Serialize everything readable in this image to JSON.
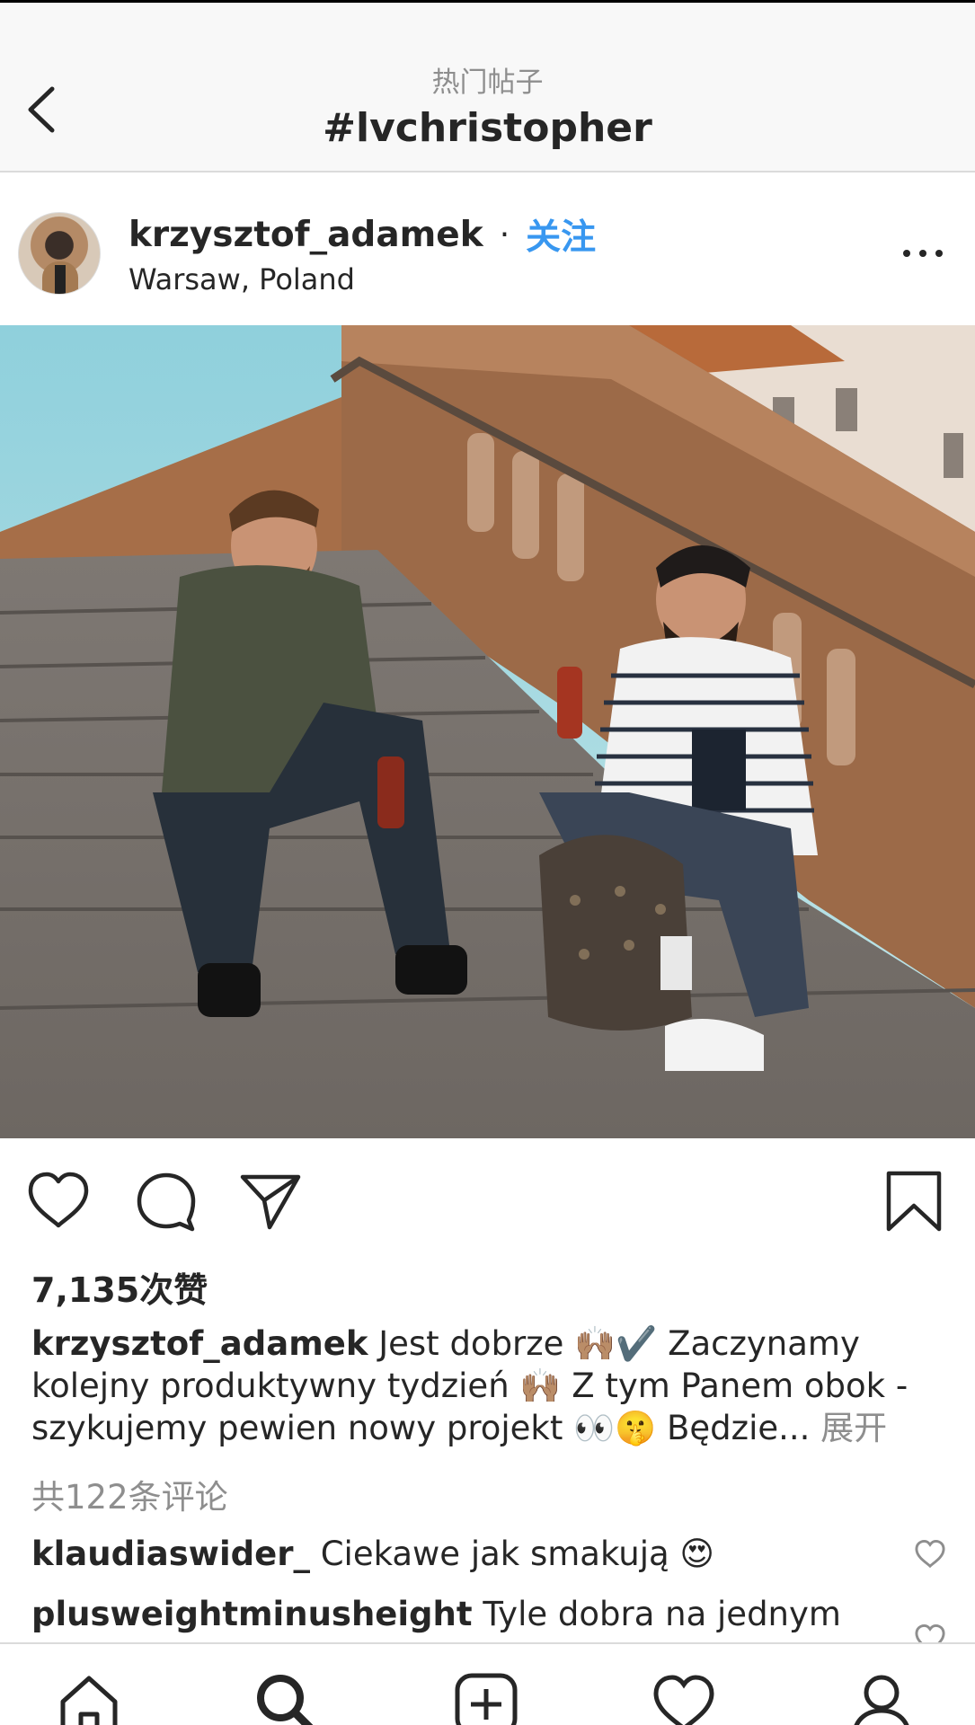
{
  "header": {
    "subtitle": "热门帖子",
    "title": "#lvchristopher"
  },
  "post": {
    "username": "krzysztof_adamek",
    "separator": "·",
    "follow_label": "关注",
    "location": "Warsaw, Poland",
    "image_alt": "Two men sitting on old stone stairs with drinks and a monogram backpack"
  },
  "likes": "7,135次赞",
  "caption": {
    "username": "krzysztof_adamek",
    "text": "Jest dobrze 🙌🏽✔️ Zaczynamy kolejny produktywny tydzień 🙌🏽 Z tym Panem obok - szykujemy pewien nowy projekt 👀🤫 Będzie...",
    "more": "展开"
  },
  "view_comments": "共122条评论",
  "comments": [
    {
      "username": "klaudiaswider_",
      "text": "Ciekawe jak smakują 😍"
    },
    {
      "username": "plusweightminusheight",
      "text": "Tyle dobra na jednym"
    }
  ],
  "icons": {
    "back": "chevron-left-icon",
    "more": "more-horizontal-icon",
    "like": "heart-outline-icon",
    "comment": "speech-bubble-icon",
    "share": "paper-plane-icon",
    "save": "bookmark-icon",
    "nav": [
      "home-icon",
      "search-icon",
      "add-post-icon",
      "activity-heart-icon",
      "profile-icon"
    ]
  },
  "colors": {
    "accent": "#3897f0",
    "secondary_text": "#8e8e8e",
    "primary_text": "#262626"
  }
}
